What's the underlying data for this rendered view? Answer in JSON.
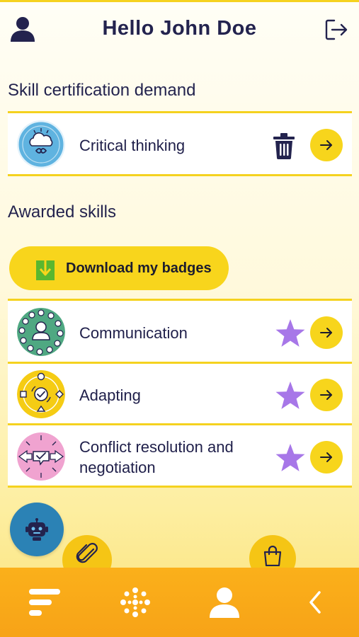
{
  "header": {
    "title": "Hello John Doe",
    "user_icon": "user-icon",
    "logout_icon": "logout-icon"
  },
  "demand_section": {
    "title": "Skill certification demand",
    "items": [
      {
        "label": "Critical thinking",
        "emblem_icon": "brain-cloud-emblem",
        "emblem_color": "#5fb3e0",
        "action_icon": "trash-icon"
      }
    ]
  },
  "awarded_section": {
    "title": "Awarded skills",
    "download_label": "Download my badges",
    "download_icon": "download-icon",
    "items": [
      {
        "label": "Communication",
        "emblem_icon": "communication-emblem",
        "emblem_color": "#4fa882",
        "action_icon": "star-icon"
      },
      {
        "label": "Adapting",
        "emblem_icon": "adapting-emblem",
        "emblem_color": "#f5cc14",
        "action_icon": "star-icon"
      },
      {
        "label": "Conflict resolution and negotiation",
        "emblem_icon": "conflict-emblem",
        "emblem_color": "#f0a3d0",
        "action_icon": "star-icon"
      }
    ]
  },
  "fabs": {
    "chatbot_icon": "robot-icon",
    "attach_icon": "paperclip-icon",
    "shop_icon": "shopping-bag-icon"
  },
  "bottom_nav": {
    "items": [
      "menu-icon",
      "dots-grid-icon",
      "profile-icon",
      "back-icon"
    ]
  },
  "colors": {
    "accent": "#f7d51c",
    "nav_bg": "#fbb01a",
    "text": "#1f1f4a",
    "star": "#a777e8",
    "chatbot": "#2b82b5"
  }
}
